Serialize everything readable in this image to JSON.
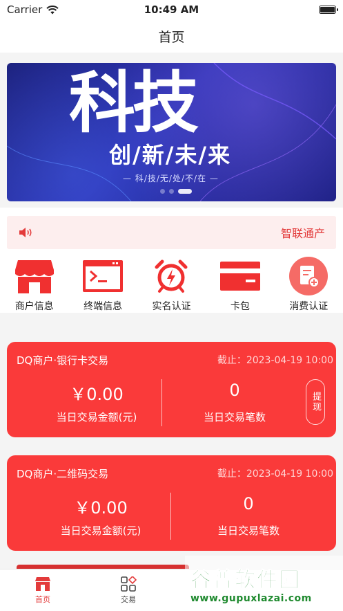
{
  "status_bar": {
    "carrier": "Carrier",
    "time": "10:49 AM"
  },
  "nav": {
    "title": "首页"
  },
  "banner": {
    "big_text": "科技",
    "sub_text": "创/新/未/来",
    "tagline": "— 科/技/无/处/不/在 —"
  },
  "notice": {
    "text": "智联通产",
    "icon": "speaker-icon"
  },
  "quick_actions": [
    {
      "label": "商户信息",
      "icon": "shop-icon"
    },
    {
      "label": "终端信息",
      "icon": "terminal-icon"
    },
    {
      "label": "实名认证",
      "icon": "alarm-clock-icon"
    },
    {
      "label": "卡包",
      "icon": "card-icon"
    },
    {
      "label": "消费认证",
      "icon": "document-add-icon"
    }
  ],
  "cards": [
    {
      "title": "DQ商户·银行卡交易",
      "date": "截止：2023-04-19 10:00",
      "amount": "￥0.00",
      "amount_label": "当日交易金额(元)",
      "count": "0",
      "count_label": "当日交易笔数",
      "action": "提现"
    },
    {
      "title": "DQ商户·二维码交易",
      "date": "截止：2023-04-19 10:00",
      "amount": "￥0.00",
      "amount_label": "当日交易金额(元)",
      "count": "0",
      "count_label": "当日交易笔数"
    }
  ],
  "tabbar": [
    {
      "label": "首页",
      "icon": "home-shop-icon",
      "active": true
    },
    {
      "label": "交易",
      "icon": "grid-icon",
      "active": false
    }
  ],
  "watermark": {
    "title": "谷普软件园",
    "url": "www.gupuxlazai.com"
  },
  "colors": {
    "accent": "#fa3a3a",
    "notice_bg": "#fdeeee",
    "banner": "#1f2599"
  }
}
